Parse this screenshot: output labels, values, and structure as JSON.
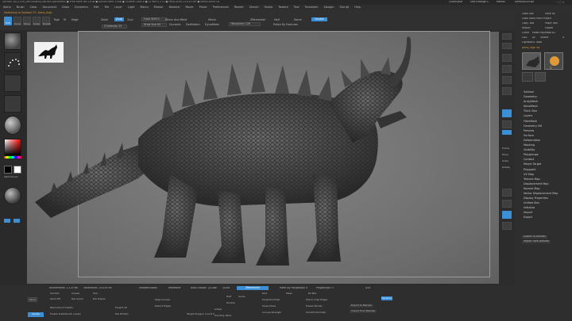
{
  "title_bar": {
    "text": "ZBrush 2021.5.6 [Ted Kildahl]   ZBrush Document   ● Free Mem 89.21GB ● Active Mem 1946 ● Scratch Disk 8 ● ZTime 0.172 ● PolyCount 23.035 MP ● MeshCount 18",
    "right_items": [
      "QuickSave",
      "See-through 0",
      "Menus",
      "DefaultZScript"
    ]
  },
  "menu_bar": {
    "items": [
      "Alpha",
      "Brush",
      "Color",
      "Document",
      "Draw",
      "Dynamics",
      "Edit",
      "File",
      "Layer",
      "Light",
      "Macro",
      "Marker",
      "Material",
      "Movie",
      "Picker",
      "Preferences",
      "Render",
      "Stencil",
      "Stroke",
      "Texture",
      "Tool",
      "Transform",
      "Zplugin",
      "Zscript",
      "Help"
    ]
  },
  "toolbar": {
    "status": "Switching to Subtool 27: Armo_high",
    "status_word": "Armo_high",
    "buttons": [
      "Edit",
      "Draw",
      "Move",
      "Scale",
      "Rotate"
    ],
    "items": {
      "rgb": "Rgb",
      "m": "M",
      "mrgb": "Mrgb",
      "zadd": "Zadd",
      "zsub": "Zsub",
      "zcut": "Zcut",
      "focal": "Focal Shift 0",
      "draw_size": "Draw Size 64",
      "dynamic": "Dynamic",
      "z_intensity": "Z Intensity 25",
      "rgb_intensity": "Rgb Intensity 100",
      "mirror_weld": "Mirror And Weld",
      "mirror": "Mirror",
      "delhidden": "DelHidden",
      "dynamesh": "DynaMesh",
      "resolution": "Resolution 128",
      "polish": "Polish By Features",
      "active_points": "ActivePoints: 1.125 Mil",
      "total_points": "TotalPoints: 23.035 Mil",
      "zremesher": "ZRemesher",
      "half": "Half",
      "same": "Same",
      "double": "Double"
    }
  },
  "left_panel": {
    "labels": [
      "Standard",
      "Dots",
      "Alpha Off",
      "Texture Off",
      "MatCap Gray",
      "Gradient",
      "SwitchColor",
      "Alternate"
    ]
  },
  "viewport": {
    "thumbnail_alt": "Kaiju silhouette"
  },
  "right_shelf": {
    "icons": [
      "Bpr",
      "SPix 3",
      "Scroll",
      "Zoom",
      "Actual",
      "AAHalf",
      "Persp",
      "Floor",
      "Local",
      "LSym",
      "Frame",
      "Move",
      "Scale",
      "Rotate",
      "Line Fill",
      "PolyF",
      "Transp",
      "Ghost",
      "Solo",
      "Xpose"
    ]
  },
  "tool_palette": {
    "top_buttons": [
      "Load Tool",
      "Save As",
      "Load Tools From Project",
      "Copy Tool",
      "Paste Tool",
      "Import",
      "Export",
      "Clone",
      "Make PolyMesh3D",
      "GoZ",
      "All",
      "Visible",
      "R",
      "Lightbox ▸ Tools",
      "Armo_high 48"
    ],
    "thumbs": [
      "Armo_high",
      "SimpleBrush",
      "PolyMesh3D",
      "Armo_high"
    ],
    "items": [
      "Subtool",
      "Geometry",
      "ArrayMesh",
      "NanoMesh",
      "Thick Skin",
      "Layers",
      "FiberMesh",
      "Geometry HD",
      "Preview",
      "Surface",
      "Deformation",
      "Masking",
      "Visibility",
      "Polygroups",
      "Contact",
      "Morph Target",
      "Polypaint",
      "UV Map",
      "Texture Map",
      "Displacement Map",
      "Normal Map",
      "Vector Displacement Map",
      "Display Properties",
      "Unified Skin",
      "Initialize",
      "Import",
      "Export"
    ],
    "footer": [
      "Export to Blender",
      "Import from Blender"
    ]
  },
  "bottom": {
    "row1": [
      "ActivePoints: 1.125 Mil",
      "TotalPoints: 23.035 Mil",
      "SmoothSubdiv",
      "ReMesher",
      "Auto Groups",
      "QCube",
      "QGrid",
      "ZRemesher"
    ],
    "row2": [
      "Mesh By Polygroups 0",
      "Polygroups: 0"
    ],
    "col_a": [
      "Store",
      "Smooth",
      "Crease",
      "UVs",
      "Store MT",
      "Del Lower",
      "Del Higher",
      "Divide",
      "Reconstruct Subdiv",
      "Freeze SubDivision Levels",
      "Project All",
      "Del Hidden"
    ],
    "col_b": [
      "Keep Groups",
      "Detect Edges",
      "Target Polygon Count 5",
      "Half",
      "Same",
      "Double",
      "Adapt",
      "Use Poly Paint"
    ],
    "col_c": [
      "Dist",
      "Mean",
      "PA Blur",
      "ProjectionShell",
      "Close Holes",
      "Curves Strength",
      "Freeze Border",
      "Smooth Normals",
      "Polish Crisp Edges"
    ],
    "export_items": [
      "Export to Blender",
      "Import from Blender",
      "GoZ",
      "Dynamic"
    ]
  },
  "colors": {
    "accent": "#3a8fd6",
    "bg": "#2b2b2b",
    "viewport": "#7a7a7a",
    "orange": "#e09a3a"
  }
}
